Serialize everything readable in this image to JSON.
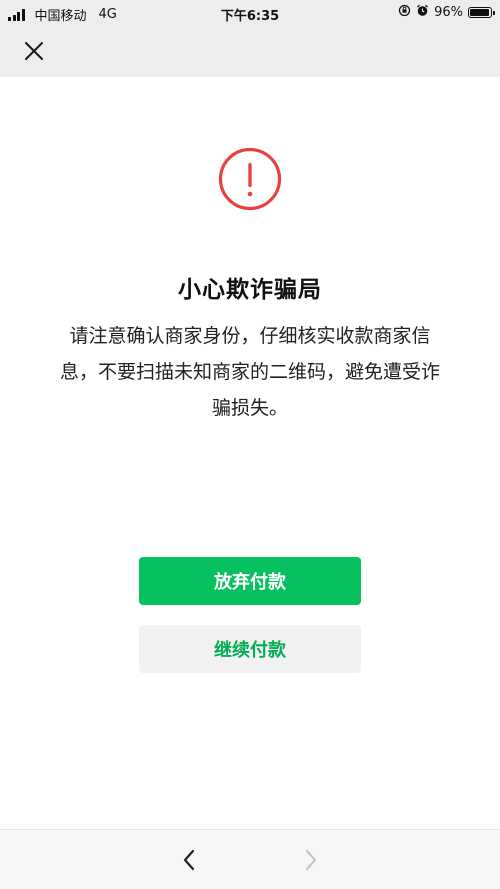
{
  "status_bar": {
    "carrier": "中国移动",
    "network": "4G",
    "time": "下午6:35",
    "battery": "96%",
    "battery_level": 0.96,
    "icons": [
      "signal-icon",
      "orientation-lock-icon",
      "alarm-icon",
      "battery-icon"
    ]
  },
  "nav_bar": {
    "close_icon": "close-icon"
  },
  "warning": {
    "icon": "exclamation-circle-icon",
    "icon_color": "#e64340",
    "title": "小心欺诈骗局",
    "desc_lines": [
      "请注意确认商家身份，仔细核实收款商家信",
      "息，不要扫描未知商家的二维码，避免遭受诈",
      "骗损失。"
    ]
  },
  "actions": {
    "abandon_label": "放弃付款",
    "continue_label": "继续付款",
    "primary_color": "#07c160",
    "secondary_text_color": "#06ae56"
  },
  "bottom_bar": {
    "back_icon": "chevron-left-icon",
    "forward_icon": "chevron-right-icon",
    "forward_enabled": false
  }
}
